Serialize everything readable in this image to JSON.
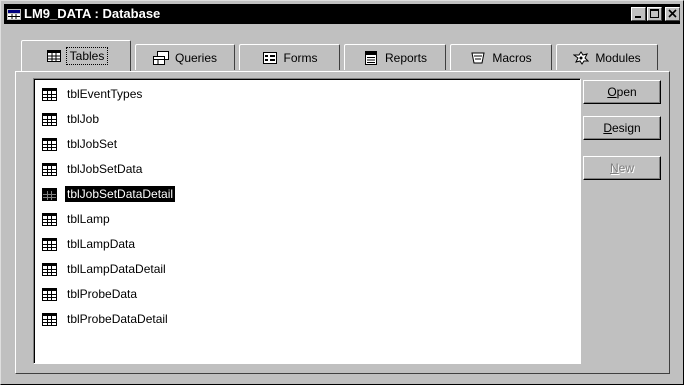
{
  "window": {
    "title": "LM9_DATA : Database",
    "controls": [
      "minimize",
      "maximize",
      "close"
    ]
  },
  "tabs": [
    {
      "label": "Tables",
      "icon": "table-icon",
      "active": true
    },
    {
      "label": "Queries",
      "icon": "query-icon",
      "active": false
    },
    {
      "label": "Forms",
      "icon": "form-icon",
      "active": false
    },
    {
      "label": "Reports",
      "icon": "report-icon",
      "active": false
    },
    {
      "label": "Macros",
      "icon": "macro-icon",
      "active": false
    },
    {
      "label": "Modules",
      "icon": "module-icon",
      "active": false
    }
  ],
  "objects": [
    {
      "label": "tblEventTypes",
      "selected": false
    },
    {
      "label": "tblJob",
      "selected": false
    },
    {
      "label": "tblJobSet",
      "selected": false
    },
    {
      "label": "tblJobSetData",
      "selected": false
    },
    {
      "label": "tblJobSetDataDetail",
      "selected": true
    },
    {
      "label": "tblLamp",
      "selected": false
    },
    {
      "label": "tblLampData",
      "selected": false
    },
    {
      "label": "tblLampDataDetail",
      "selected": false
    },
    {
      "label": "tblProbeData",
      "selected": false
    },
    {
      "label": "tblProbeDataDetail",
      "selected": false
    }
  ],
  "buttons": {
    "open": {
      "mnemonic": "O",
      "rest": "pen",
      "enabled": true
    },
    "design": {
      "mnemonic": "D",
      "rest": "esign",
      "enabled": true
    },
    "new": {
      "mnemonic": "N",
      "rest": "ew",
      "enabled": false
    }
  }
}
